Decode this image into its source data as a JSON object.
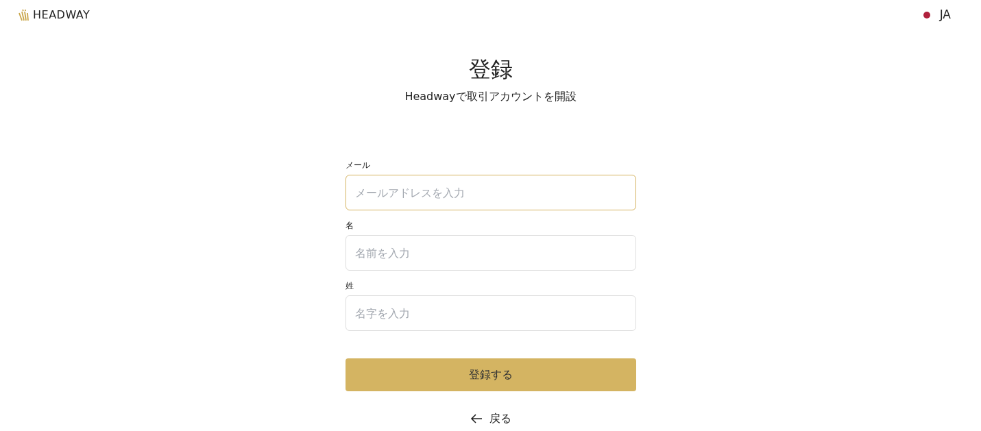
{
  "header": {
    "logo_text": "HEADWAY",
    "language": {
      "label": "JA",
      "color": "#b0213d"
    }
  },
  "title": "登録",
  "subtitle": "Headwayで取引アカウントを開設",
  "fields": [
    {
      "label": "メール",
      "placeholder": "メールアドレスを入力",
      "focused": true
    },
    {
      "label": "名",
      "placeholder": "名前を入力",
      "focused": false
    },
    {
      "label": "姓",
      "placeholder": "名字を入力",
      "focused": false
    }
  ],
  "submit_button": "登録する",
  "back_link": "戻る"
}
